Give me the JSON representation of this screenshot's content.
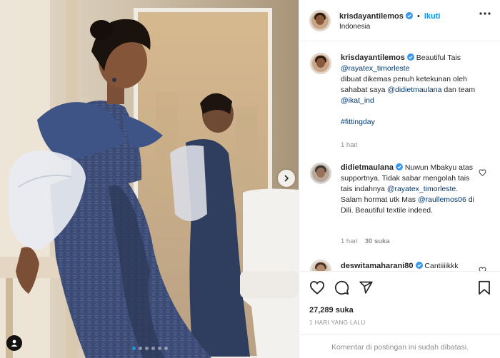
{
  "post": {
    "author": "krisdayantilemos",
    "follow_label": "Ikuti",
    "location": "Indonesia",
    "carousel": {
      "total": 6,
      "active": 0
    }
  },
  "caption": {
    "username": "krisdayantilemos",
    "title": "Beautiful Tais",
    "mention1": "@rayatex_timorleste",
    "text1": "dibuat dikemas penuh ketekunan oleh sahabat saya",
    "mention2": "@didietmaulana",
    "text2": "dan team",
    "mention3": "@ikat_ind",
    "hashtag": "#fittingday",
    "time": "1 hari"
  },
  "comments": [
    {
      "username": "didietmaulana",
      "text1": "Nuwun Mbakyu atas supportnya. Tidak sabar mengolah tais tais indahnya",
      "mention1": "@rayatex_timorleste",
      "text2": ". Salam hormat utk Mas",
      "mention2": "@raullemos06",
      "text3": "di Dili. Beautiful textile indeed.",
      "time": "1 hari",
      "likes": "30 suka"
    },
    {
      "username": "deswitamaharani80",
      "text1": "Cantiiiikkk"
    }
  ],
  "footer": {
    "likes": "27,289 suka",
    "time_ago": "1 HARI YANG LALU",
    "comments_disabled": "Komentar di postingan ini sudah dibatasi."
  },
  "colors": {
    "accent": "#0095f6",
    "verified": "#3897f0",
    "mention": "#00376b",
    "muted": "#8e8e8e"
  },
  "icons": [
    "more-icon",
    "verified-badge-icon",
    "heart-icon",
    "comment-icon",
    "share-icon",
    "bookmark-icon",
    "chevron-right-icon",
    "user-tag-icon"
  ]
}
